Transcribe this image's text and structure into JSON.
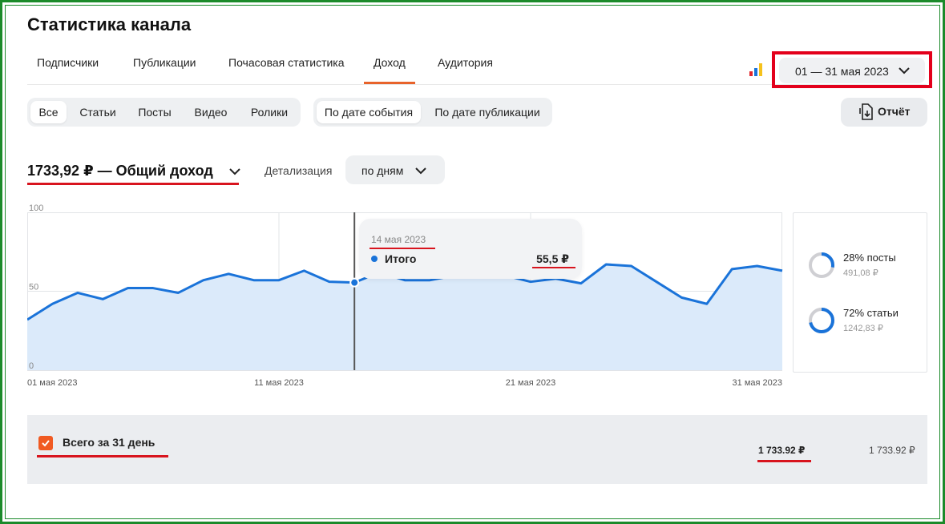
{
  "page": {
    "title": "Статистика канала"
  },
  "tabs": [
    {
      "label": "Подписчики"
    },
    {
      "label": "Публикации"
    },
    {
      "label": "Почасовая статистика"
    },
    {
      "label": "Доход",
      "active": true
    },
    {
      "label": "Аудитория"
    }
  ],
  "date_range": {
    "label": "01 — 31 мая 2023"
  },
  "content_filter": {
    "options": [
      "Все",
      "Статьи",
      "Посты",
      "Видео",
      "Ролики"
    ],
    "selected": "Все"
  },
  "date_mode_filter": {
    "options": [
      "По дате события",
      "По дате публикации"
    ],
    "selected": "По дате события"
  },
  "report_button": {
    "label": "Отчёт"
  },
  "income": {
    "label": "1733,92 ₽ — Общий доход"
  },
  "detail": {
    "label": "Детализация",
    "value": "по дням"
  },
  "tooltip": {
    "date": "14 мая 2023",
    "series": "Итого",
    "value": "55,5 ₽"
  },
  "breakdown": [
    {
      "pct_label": "28% посты",
      "value": "491,08 ₽",
      "fraction": 0.28
    },
    {
      "pct_label": "72% статьи",
      "value": "1242,83 ₽",
      "fraction": 0.72
    }
  ],
  "total": {
    "label": "Всего за 31 день",
    "value_main": "1 733.92 ₽",
    "value_secondary": "1 733.92 ₽"
  },
  "colors": {
    "accent": "#e8632b",
    "line": "#1a73d9",
    "area": "#dbeafa",
    "highlight": "#d8141e",
    "frame": "#1b8a2a",
    "checkbox": "#f05a22"
  },
  "chart_data": {
    "type": "area",
    "x_labels_shown": [
      "01 мая 2023",
      "11 мая 2023",
      "21 мая 2023",
      "31 мая 2023"
    ],
    "y_ticks": [
      "100",
      "50",
      "0"
    ],
    "ylim": [
      0,
      100
    ],
    "x": [
      1,
      2,
      3,
      4,
      5,
      6,
      7,
      8,
      9,
      10,
      11,
      12,
      13,
      14,
      15,
      16,
      17,
      18,
      19,
      20,
      21,
      22,
      23,
      24,
      25,
      26,
      27,
      28,
      29,
      30,
      31
    ],
    "series": [
      {
        "values": [
          32,
          42,
          49,
          45,
          52,
          52,
          49,
          57,
          61,
          57,
          57,
          63,
          56,
          55.5,
          62,
          57,
          57,
          60,
          61,
          60,
          56,
          58,
          55,
          67,
          66,
          56,
          46,
          42,
          64,
          66,
          63
        ]
      }
    ],
    "highlight_x": 14,
    "grid": true
  }
}
